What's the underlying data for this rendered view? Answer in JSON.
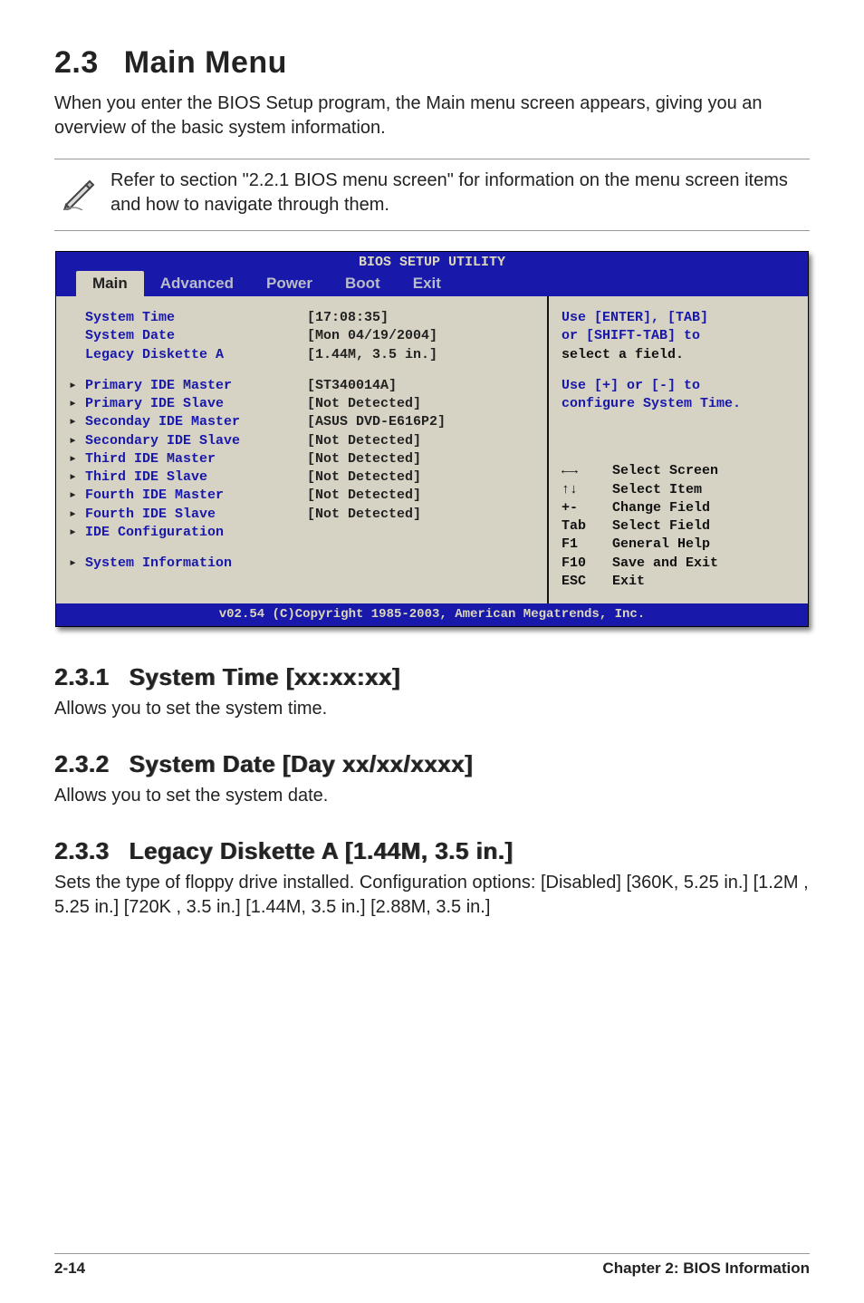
{
  "section": {
    "number": "2.3",
    "title": "Main Menu",
    "intro": "When you enter the BIOS Setup program, the Main menu screen appears, giving you an overview of the basic system information.",
    "note": "Refer to section \"2.2.1  BIOS menu screen\" for information on the menu screen items and how to navigate through them."
  },
  "bios": {
    "utility_title": "BIOS SETUP UTILITY",
    "tabs": [
      "Main",
      "Advanced",
      "Power",
      "Boot",
      "Exit"
    ],
    "active_tab": "Main",
    "top_fields": [
      {
        "label": "System Time",
        "value": "[17:08:35]"
      },
      {
        "label": "System Date",
        "value": "[Mon 04/19/2004]"
      },
      {
        "label": "Legacy Diskette A",
        "value": "[1.44M, 3.5 in.]"
      }
    ],
    "ide_fields": [
      {
        "label": "Primary IDE Master",
        "value": "[ST340014A]"
      },
      {
        "label": "Primary IDE Slave",
        "value": "[Not Detected]"
      },
      {
        "label": "Seconday IDE Master",
        "value": "[ASUS DVD-E616P2]"
      },
      {
        "label": "Secondary IDE Slave",
        "value": "[Not Detected]"
      },
      {
        "label": "Third IDE Master",
        "value": "[Not Detected]"
      },
      {
        "label": "Third IDE Slave",
        "value": "[Not Detected]"
      },
      {
        "label": "Fourth IDE Master",
        "value": "[Not Detected]"
      },
      {
        "label": "Fourth IDE Slave",
        "value": "[Not Detected]"
      },
      {
        "label": "IDE Configuration",
        "value": ""
      }
    ],
    "extra_fields": [
      {
        "label": "System Information",
        "value": ""
      }
    ],
    "help_top": [
      "Use [ENTER], [TAB]",
      "or [SHIFT-TAB] to",
      "select a field."
    ],
    "help_mid": [
      "Use [+] or [-] to",
      "configure System Time."
    ],
    "keys": [
      {
        "k": "←→",
        "d": "Select Screen"
      },
      {
        "k": "↑↓",
        "d": "Select Item"
      },
      {
        "k": "+-",
        "d": "Change Field"
      },
      {
        "k": "Tab",
        "d": "Select Field"
      },
      {
        "k": "F1",
        "d": "General Help"
      },
      {
        "k": "F10",
        "d": "Save and Exit"
      },
      {
        "k": "ESC",
        "d": "Exit"
      }
    ],
    "footer": "v02.54 (C)Copyright 1985-2003, American Megatrends, Inc."
  },
  "subs": {
    "s1": {
      "num": "2.3.1",
      "title": "System Time [xx:xx:xx]",
      "text": "Allows you to set the system time."
    },
    "s2": {
      "num": "2.3.2",
      "title": "System Date [Day xx/xx/xxxx]",
      "text": "Allows you to set the system date."
    },
    "s3": {
      "num": "2.3.3",
      "title": "Legacy Diskette A [1.44M, 3.5 in.]",
      "text": "Sets the type of floppy drive installed. Configuration options: [Disabled] [360K, 5.25 in.] [1.2M , 5.25 in.] [720K , 3.5 in.] [1.44M, 3.5 in.] [2.88M, 3.5 in.]"
    }
  },
  "page_footer": {
    "left": "2-14",
    "right": "Chapter 2: BIOS Information"
  }
}
